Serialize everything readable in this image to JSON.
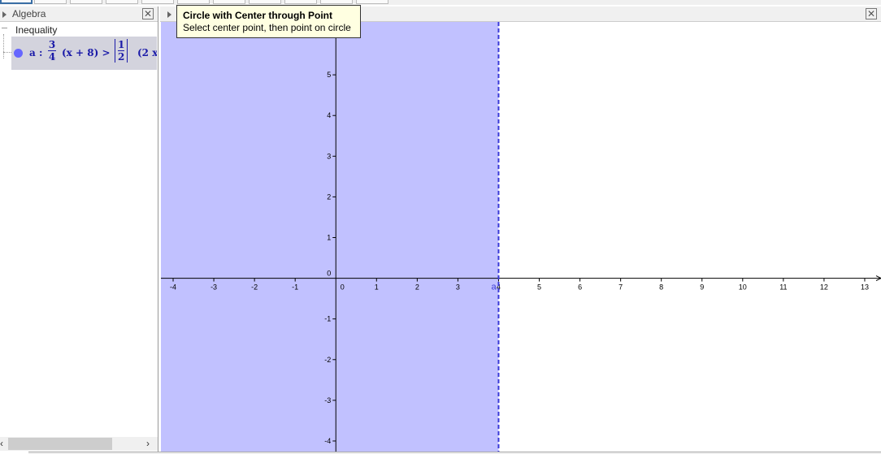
{
  "algebra": {
    "title": "Algebra",
    "category": "Inequality",
    "item_label": "a :",
    "frac1_num": "3",
    "frac1_den": "4",
    "expr1": "(x + 8) >",
    "frac2_num": "1",
    "frac2_den": "2",
    "expr2": "(2 x",
    "color": "#6666ff"
  },
  "graphics": {
    "fill_color": "#c1c1ff",
    "boundary_label": "a",
    "boundary_x": 4,
    "xmin": -4.3,
    "xmax": 13.4,
    "ymin": -4.26,
    "ymax": 6.3,
    "x_ticks": [
      "-4",
      "-3",
      "-2",
      "-1",
      "0",
      "1",
      "2",
      "3",
      "4",
      "5",
      "6",
      "7",
      "8",
      "9",
      "10",
      "11",
      "12",
      "13"
    ],
    "y_ticks": [
      "-4",
      "-3",
      "-2",
      "-1",
      "0",
      "1",
      "2",
      "3",
      "4",
      "5"
    ]
  },
  "tooltip": {
    "title": "Circle with Center through Point",
    "text": "Select center point, then point on circle"
  },
  "icons": {
    "close": "close-icon",
    "expand": "triangle-right-icon"
  }
}
